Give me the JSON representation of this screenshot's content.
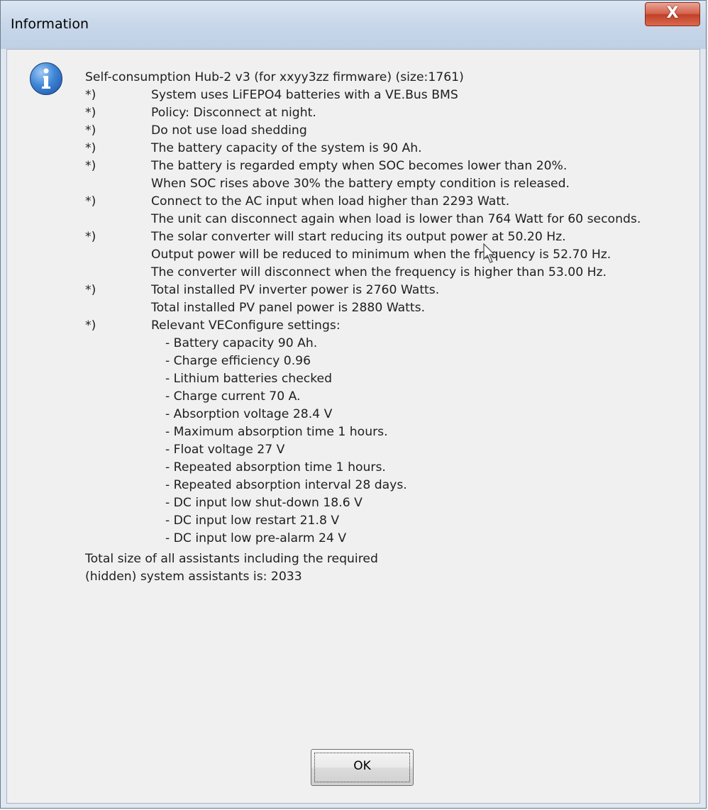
{
  "window": {
    "title": "Information",
    "close_label": "X"
  },
  "icon": "info-icon",
  "message": {
    "header": "Self-consumption Hub-2 v3 (for xxyy3zz firmware) (size:1761)",
    "bullet_marker": "*)",
    "lines": [
      {
        "bullet": true,
        "text": "System uses LiFEPO4 batteries with a VE.Bus BMS"
      },
      {
        "bullet": true,
        "text": "Policy: Disconnect at night."
      },
      {
        "bullet": true,
        "text": "Do not use load shedding"
      },
      {
        "bullet": true,
        "text": "The battery capacity of the system is 90 Ah."
      },
      {
        "bullet": true,
        "text": "The battery is regarded empty when SOC becomes lower than 20%."
      },
      {
        "bullet": false,
        "text": "When SOC rises above 30% the battery empty condition is released."
      },
      {
        "bullet": true,
        "text": "Connect to the AC input when load higher than 2293 Watt."
      },
      {
        "bullet": false,
        "text": "The unit can disconnect again when load is lower than 764 Watt for 60 seconds."
      },
      {
        "bullet": true,
        "text": "The solar converter will start reducing its output power at 50.20 Hz."
      },
      {
        "bullet": false,
        "text": "Output power will be reduced to minimum when the frequency is  52.70 Hz."
      },
      {
        "bullet": false,
        "text": "The converter will disconnect when the frequency is higher than  53.00 Hz."
      },
      {
        "bullet": true,
        "text": "Total installed PV inverter power is 2760 Watts."
      },
      {
        "bullet": false,
        "text": "Total installed PV panel power is 2880 Watts."
      },
      {
        "bullet": true,
        "text": "Relevant VEConfigure settings:"
      }
    ],
    "settings": [
      "- Battery capacity 90 Ah.",
      "- Charge efficiency 0.96",
      "- Lithium batteries checked",
      "- Charge current 70 A.",
      "- Absorption voltage 28.4 V",
      "- Maximum absorption time 1 hours.",
      "- Float voltage 27 V",
      "- Repeated absorption time 1 hours.",
      "- Repeated absorption interval 28 days.",
      "- DC input low shut-down 18.6 V",
      "- DC input low restart 21.8 V",
      "- DC input low pre-alarm 24 V"
    ],
    "totals": [
      "Total size of all assistants including the required",
      "(hidden) system assistants is: 2033"
    ]
  },
  "buttons": {
    "ok_label": "OK"
  }
}
